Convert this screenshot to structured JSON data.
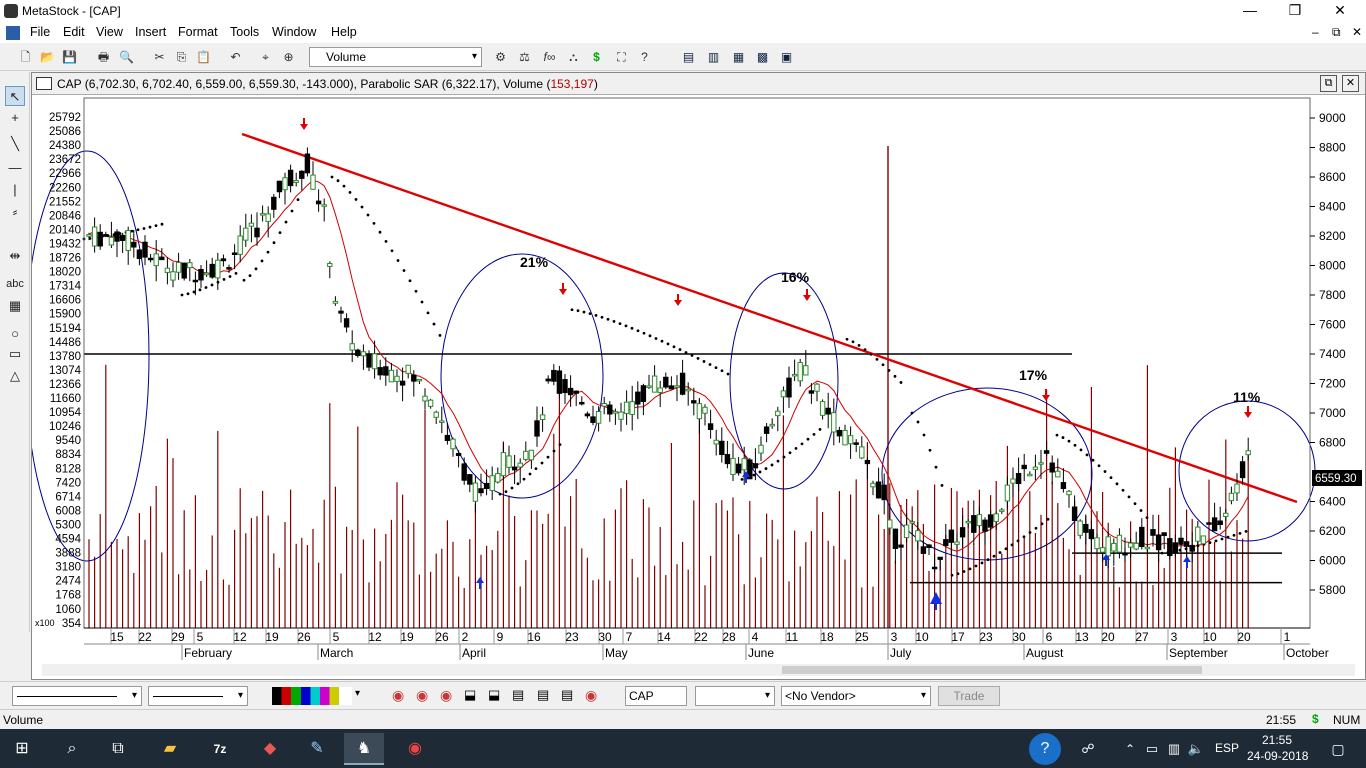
{
  "window": {
    "title": "MetaStock - [CAP]",
    "min": "—",
    "max": "❐",
    "close": "✕"
  },
  "menu": [
    "File",
    "Edit",
    "View",
    "Insert",
    "Format",
    "Tools",
    "Window",
    "Help"
  ],
  "toolbar": {
    "indicator_select": "Volume"
  },
  "chart": {
    "header": "CAP (6,702.30, 6,702.40, 6,559.00, 6,559.30, -143.000), Parabolic SAR (6,322.17), Volume (",
    "header_volume": "153,197",
    "header_tail": ")",
    "last_price_label": "6559.30",
    "volume_scale_label": "x100",
    "annotations": [
      "21%",
      "16%",
      "17%",
      "11%"
    ]
  },
  "chart_data": {
    "type": "candlestick",
    "title": "CAP",
    "price_axis": [
      "9000",
      "8800",
      "8600",
      "8400",
      "8200",
      "8000",
      "7800",
      "7600",
      "7400",
      "7200",
      "7000",
      "6800",
      "6559.30",
      "6400",
      "6200",
      "6000",
      "5800"
    ],
    "volume_axis": [
      "25792",
      "25086",
      "24380",
      "23672",
      "22966",
      "22260",
      "21552",
      "20846",
      "20140",
      "19432",
      "18726",
      "18020",
      "17314",
      "16606",
      "15900",
      "15194",
      "14486",
      "13780",
      "13074",
      "12366",
      "11660",
      "10954",
      "10246",
      "9540",
      "8834",
      "8128",
      "7420",
      "6714",
      "6008",
      "5300",
      "4594",
      "3888",
      "3180",
      "2474",
      "1768",
      "1060",
      "354"
    ],
    "x_day_ticks": [
      "15",
      "22",
      "29",
      "5",
      "12",
      "19",
      "26",
      "5",
      "12",
      "19",
      "26",
      "2",
      "9",
      "16",
      "23",
      "30",
      "7",
      "14",
      "22",
      "28",
      "4",
      "11",
      "18",
      "25",
      "3",
      "10",
      "17",
      "23",
      "30",
      "6",
      "13",
      "20",
      "27",
      "3",
      "10",
      "20",
      "1"
    ],
    "months": [
      "February",
      "March",
      "April",
      "May",
      "June",
      "July",
      "August",
      "September",
      "October"
    ],
    "last_close": 6559.3,
    "parabolic_sar": 6322.17,
    "volume": 153197
  },
  "bottom": {
    "symbol_field": "CAP",
    "vendor_select": "<No Vendor>",
    "trade_button": "Trade"
  },
  "status": {
    "left": "Volume",
    "time": "21:55",
    "num": "NUM"
  },
  "taskbar": {
    "time": "21:55",
    "date": "24-09-2018",
    "lang": "ESP"
  }
}
